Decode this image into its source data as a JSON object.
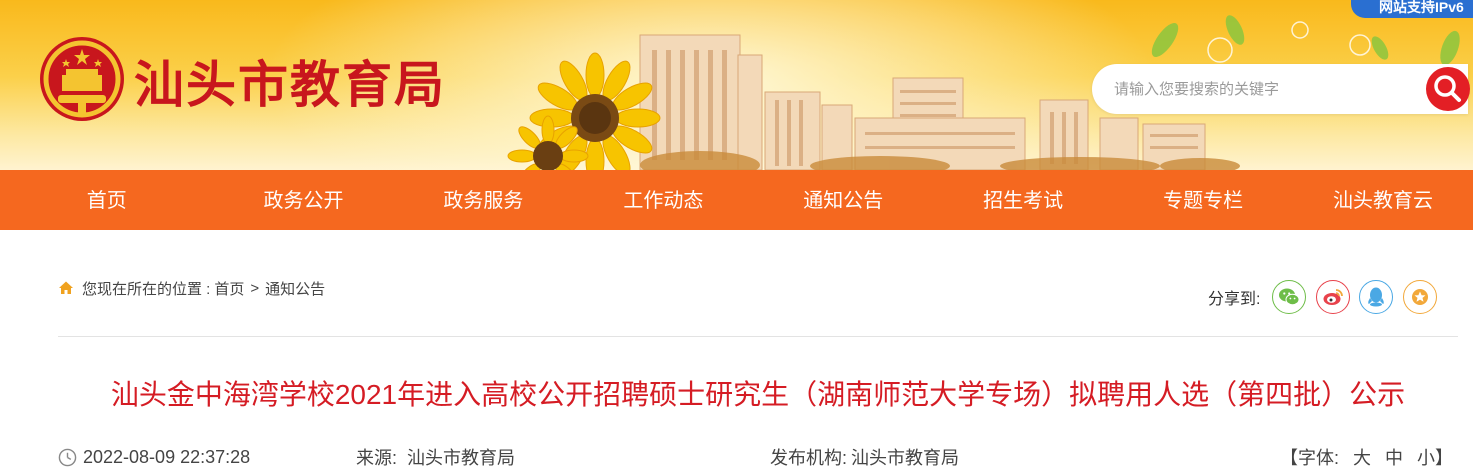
{
  "header": {
    "site_title": "汕头市教育局",
    "ipv6_badge": "网站支持IPv6",
    "search": {
      "placeholder": "请输入您要搜索的关键字"
    },
    "colors": {
      "banner": "#f9b91c",
      "title": "#c8161d",
      "search_button": "#e31f25"
    }
  },
  "nav": {
    "color": "#f5681f",
    "items": [
      {
        "label": "首页"
      },
      {
        "label": "政务公开"
      },
      {
        "label": "政务服务"
      },
      {
        "label": "工作动态"
      },
      {
        "label": "通知公告"
      },
      {
        "label": "招生考试"
      },
      {
        "label": "专题专栏"
      },
      {
        "label": "汕头教育云"
      }
    ]
  },
  "breadcrumb": {
    "prefix": "您现在所在的位置 :",
    "items": [
      {
        "label": "首页"
      },
      {
        "label": "通知公告"
      }
    ],
    "separator": ">"
  },
  "share": {
    "label": "分享到:",
    "buttons": [
      {
        "name": "wechat-icon",
        "color": "#6ebd48"
      },
      {
        "name": "weibo-icon",
        "color": "#e8424b"
      },
      {
        "name": "qq-icon",
        "color": "#4aa8e4"
      },
      {
        "name": "star-icon",
        "color": "#f2a83a"
      }
    ]
  },
  "article": {
    "title": "汕头金中海湾学校2021年进入高校公开招聘硕士研究生（湖南师范大学专场）拟聘用人选（第四批）公示",
    "title_color": "#d51c24",
    "datetime": "2022-08-09 22:37:28",
    "source_label": "来源:",
    "source_value": "汕头市教育局",
    "org_label": "发布机构:",
    "org_value": "汕头市教育局",
    "font_label": "【字体:",
    "font_large": "大",
    "font_medium": "中",
    "font_small": "小】"
  }
}
